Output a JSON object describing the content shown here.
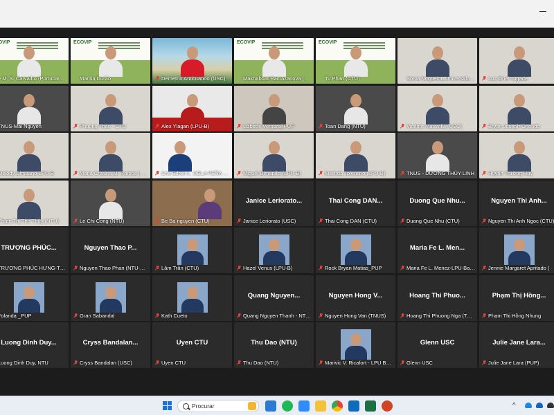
{
  "participants": [
    {
      "name": "e M. S. Carvalho (Portucalens...",
      "type": "ecovip",
      "muted": false
    },
    {
      "name": "Marília Durão",
      "type": "ecovip",
      "muted": false
    },
    {
      "name": "Demetrio Anticuando (USC)",
      "type": "beach",
      "muted": true
    },
    {
      "name": "Makhabbat Ramazanova (UPT)",
      "type": "ecovip",
      "muted": false
    },
    {
      "name": "Tu Phan (CTU)",
      "type": "ecovip",
      "muted": false
    },
    {
      "name": "Sónia Nogueira_Universidade...",
      "type": "room",
      "muted": false
    },
    {
      "name": "Luz Oriel Tugade",
      "type": "room",
      "muted": true
    },
    {
      "name": "TNUS-Mai Nguyen",
      "type": "dark",
      "muted": false
    },
    {
      "name": "Phuong Thao - CTU",
      "type": "room",
      "muted": true
    },
    {
      "name": "Alex Ylagan (LPU-B)",
      "type": "lpu",
      "muted": true
    },
    {
      "name": "Lizbette Vergara_PUP",
      "type": "office",
      "muted": true
    },
    {
      "name": "Toan Dang (NTU)",
      "type": "dark",
      "muted": true
    },
    {
      "name": "Vicente Maravilla (USC)",
      "type": "room",
      "muted": true
    },
    {
      "name": "Bryan Joseph Oriondo",
      "type": "room",
      "muted": true
    },
    {
      "name": "Melody Dimaano-LPU-B",
      "type": "room",
      "muted": false
    },
    {
      "name": "Maria Cristina M. Ramos | LP...",
      "type": "room",
      "muted": true
    },
    {
      "name": "Cris Edren L. DELA PEÑA (USC)",
      "type": "cris",
      "muted": true
    },
    {
      "name": "Miguel Dimapilis (LPU-B)",
      "type": "room",
      "muted": true
    },
    {
      "name": "Melinda Tolentino (LPU-B)",
      "type": "room",
      "muted": true
    },
    {
      "name": "TNUS - DƯƠNG THÙY LINH",
      "type": "dark",
      "muted": true
    },
    {
      "name": "Huỳnh Trường Huy",
      "type": "room",
      "muted": true
    },
    {
      "name": "Phạm Thị Thu Thủy (NTU)",
      "type": "room",
      "muted": false
    },
    {
      "name": "Le Chi Cong (NTU)",
      "type": "dark",
      "muted": true
    },
    {
      "name": "Be Ba nguyen (CTU)",
      "type": "shelf",
      "muted": true
    },
    {
      "name": "Janice Leriorato (USC)",
      "type": "name",
      "center": "Janice Leriorato...",
      "muted": true
    },
    {
      "name": "Thai Cong DAN (CTU)",
      "type": "name",
      "center": "Thai Cong DAN...",
      "muted": true
    },
    {
      "name": "Duong Que Nhu (CTU)",
      "type": "name",
      "center": "Duong Que Nhu...",
      "muted": true
    },
    {
      "name": "Nguyen Thi Anh Ngoc (CTU)",
      "type": "name",
      "center": "Nguyen Thi Anh...",
      "muted": true
    },
    {
      "name": "TRƯƠNG PHÚC HƯNG-TNUS",
      "type": "name",
      "center": "TRƯƠNG PHÚC...",
      "muted": false
    },
    {
      "name": "Nguyen Thao Phan (NTU-VN)",
      "type": "name",
      "center": "Nguyen Thao P...",
      "muted": true
    },
    {
      "name": "Lâm Trần (CTU)",
      "type": "photo",
      "muted": true
    },
    {
      "name": "Hazel Venus (LPU-B)",
      "type": "photo",
      "muted": true
    },
    {
      "name": "Rock Bryan Matias_PUP",
      "type": "photo",
      "muted": true
    },
    {
      "name": "Maria Fe L. Menez-LPU-Batan...",
      "type": "name",
      "center": "Maria Fe L. Men...",
      "muted": true
    },
    {
      "name": "Jennie Margaret Apritado (",
      "type": "photo",
      "muted": true
    },
    {
      "name": "Yolanda _PUP",
      "type": "photo",
      "muted": false
    },
    {
      "name": "Gran Sabandal",
      "type": "photo",
      "muted": true
    },
    {
      "name": "Kath Cueto",
      "type": "photo",
      "muted": true
    },
    {
      "name": "Quang Nguyen Thanh - NTU ...",
      "type": "name",
      "center": "Quang Nguyen...",
      "muted": true
    },
    {
      "name": "Nguyen Hong Van (TNUS)",
      "type": "name",
      "center": "Nguyen Hong V...",
      "muted": true
    },
    {
      "name": "Hoang Thi Phuong Nga (TNUS)",
      "type": "name",
      "center": "Hoang Thi Phuo...",
      "muted": true
    },
    {
      "name": "Phạm Thị Hồng Nhung",
      "type": "name",
      "center": "Phạm Thị Hồng...",
      "muted": true
    },
    {
      "name": "Luong Dinh Duy, NTU",
      "type": "name",
      "center": "Luong Dinh Duy...",
      "muted": false
    },
    {
      "name": "Cryss Bandalan (USC)",
      "type": "name",
      "center": "Cryss Bandalan...",
      "muted": true
    },
    {
      "name": "Uyen CTU",
      "type": "name",
      "center": "Uyen CTU",
      "muted": true
    },
    {
      "name": "Thu Dao (NTU)",
      "type": "name",
      "center": "Thu Dao (NTU)",
      "muted": true
    },
    {
      "name": "Marivic V. Ricafort - LPU BATA...",
      "type": "photo",
      "muted": true
    },
    {
      "name": "Glenn USC",
      "type": "name",
      "center": "Glenn USC",
      "muted": true
    },
    {
      "name": "Julie Jane Lara (PUP)",
      "type": "name",
      "center": "Julie Jane  Lara...",
      "muted": true
    }
  ],
  "taskbar": {
    "search_placeholder": "Procurar"
  },
  "brand": {
    "ecovip_logo": "ECOVIP"
  },
  "colors": {
    "muted_mic": "#e0423a",
    "tile_bg": "#2b2b2b",
    "meeting_bg": "#1c1c1c",
    "taskbar_bg": "#e9edf4"
  }
}
